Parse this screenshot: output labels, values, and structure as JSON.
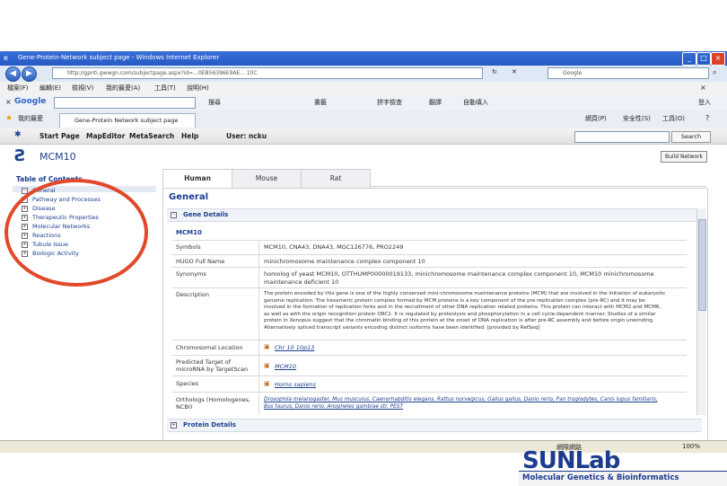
{
  "window": {
    "title": "Gene-Protein-Network subject page - Windows Internet Explorer"
  },
  "address": {
    "url": "http://gpnti.gwwgn.com/subjectpage.aspx?id=...0EB56396E9AE... 10C",
    "search_placeholder": "Google"
  },
  "menu": [
    "檔案(F)",
    "編輯(E)",
    "檢視(V)",
    "我的最愛(A)",
    "工具(T)",
    "說明(H)"
  ],
  "google_toolbar": {
    "label": "Google",
    "items": [
      "搜尋",
      "書籤",
      "拼字檢查",
      "翻譯",
      "自動填入"
    ],
    "login": "登入"
  },
  "fav_bar": {
    "favorites": "我的最愛",
    "tab_title": "Gene-Protein Network subject page",
    "right_items": [
      "網頁(P)",
      "安全性(S)",
      "工具(O)"
    ]
  },
  "app_nav": {
    "items": [
      "Start Page",
      "MapEditor",
      "MetaSearch",
      "Help",
      "User: ncku"
    ],
    "search_button": "Search"
  },
  "brand": {
    "title": "MCM10"
  },
  "build_network": "Build Network",
  "toc": {
    "title": "Table of Contents",
    "items": [
      "General",
      "Pathway and Processes",
      "Disease",
      "Therapeutic Properties",
      "Molecular Networks",
      "Reactions",
      "Tubule Issue",
      "Biologic Activity"
    ]
  },
  "tabs": [
    "Human",
    "Mouse",
    "Rat"
  ],
  "section": {
    "title": "General",
    "gene_details": "Gene Details",
    "protein_details": "Protein Details"
  },
  "gene": {
    "name": "MCM10",
    "rows": [
      {
        "label": "Symbols",
        "value": "MCM10, CNA43, DNA43, MGC126776, PRO2249"
      },
      {
        "label": "HUGO Full Name",
        "value": "minichromosome maintenance complex component 10"
      },
      {
        "label": "Synonyms",
        "value": "homolog of yeast MCM10, OTTHUMP00000019133, minichromosome maintenance complex component 10, MCM10 minichromosome maintenance deficient 10"
      },
      {
        "label": "Description",
        "value": "The protein encoded by this gene is one of the highly conserved mini-chromosome maintenance proteins (MCM) that are involved in the initiation of eukaryotic genome replication. The hexameric protein complex formed by MCM proteins is a key component of the pre-replication complex (pre-RC) and it may be involved in the formation of replication forks and in the recruitment of other DNA replication related proteins. This protein can interact with MCM2 and MCM6, as well as with the origin recognition protein ORC2. It is regulated by proteolysis and phosphorylation in a cell cycle-dependent manner. Studies of a similar protein in Xenopus suggest that the chromatin binding of this protein at the onset of DNA replication is after pre-RC assembly and before origin unwinding. Alternatively spliced transcript variants encoding distinct isoforms have been identified. [provided by RefSeq]"
      },
      {
        "label": "Chromosomal Location",
        "value": "Chr 10  10p13"
      },
      {
        "label": "Predicted Target of microRNA by TargetScan",
        "value": "MCM10"
      },
      {
        "label": "Species",
        "value": "Homo sapiens"
      },
      {
        "label": "Orthologs (Homologenes, NCBI)",
        "value": "Drosophila melanogaster, Mus musculus, Caenorhabditis elegans, Rattus norvegicus, Gallus gallus, Danio rerio, Pan troglodytes, Canis lupus familiaris, Bos taurus, Danio rerio, Anopheles gambiae str. PEST"
      }
    ]
  },
  "status": {
    "zone": "網際網路",
    "zoom": "100%"
  },
  "logo": {
    "name": "SUNLab",
    "tagline": "Molecular Genetics & Bioinformatics"
  },
  "colors": {
    "accent": "#1b3f8f",
    "annotation": "#e2482a",
    "logo": "#1d3c8f"
  }
}
